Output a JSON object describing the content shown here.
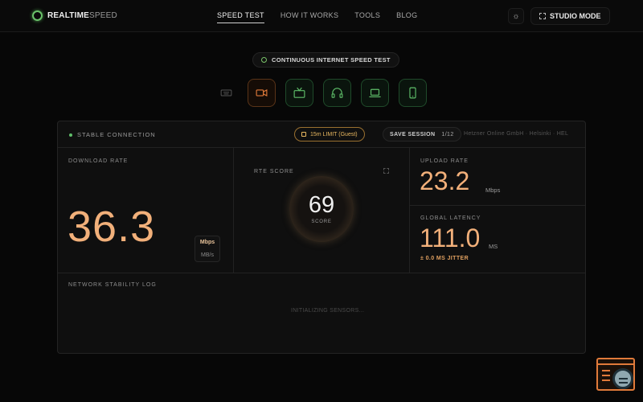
{
  "nav": {
    "logo_bold": "REALTIME",
    "logo_light": "SPEED",
    "links": [
      "SPEED TEST",
      "HOW IT WORKS",
      "TOOLS",
      "BLOG"
    ],
    "theme_icon": "sun-icon",
    "studio_label": "STUDIO MODE"
  },
  "pill": {
    "label": "CONTINUOUS INTERNET SPEED TEST"
  },
  "devices": [
    "keyboard-icon",
    "video-icon",
    "tv-icon",
    "headphones-icon",
    "laptop-icon",
    "phone-icon"
  ],
  "panel": {
    "status": "STABLE CONNECTION",
    "limit": "15m LIMIT (Guest)",
    "save_label": "SAVE SESSION",
    "save_count": "1/12",
    "host": "Hetzner Online GmbH · Helsinki · HEL",
    "download": {
      "label": "DOWNLOAD RATE",
      "value": "36.3",
      "unit_primary": "Mbps",
      "unit_secondary": "MB/s"
    },
    "rte": {
      "label": "RTE SCORE",
      "value": "69",
      "sub": "SCORE"
    },
    "upload": {
      "label": "UPLOAD RATE",
      "value": "23.2",
      "unit": "Mbps"
    },
    "latency": {
      "label": "GLOBAL LATENCY",
      "value": "111.0",
      "unit": "MS",
      "jitter": "± 0.0 MS JITTER"
    },
    "log": {
      "label": "NETWORK STABILITY LOG",
      "status": "INITIALIZING SENSORS..."
    }
  },
  "colors": {
    "accent_orange": "#f2b07a",
    "accent_green": "#6ac26a",
    "gold": "#e9b860"
  }
}
